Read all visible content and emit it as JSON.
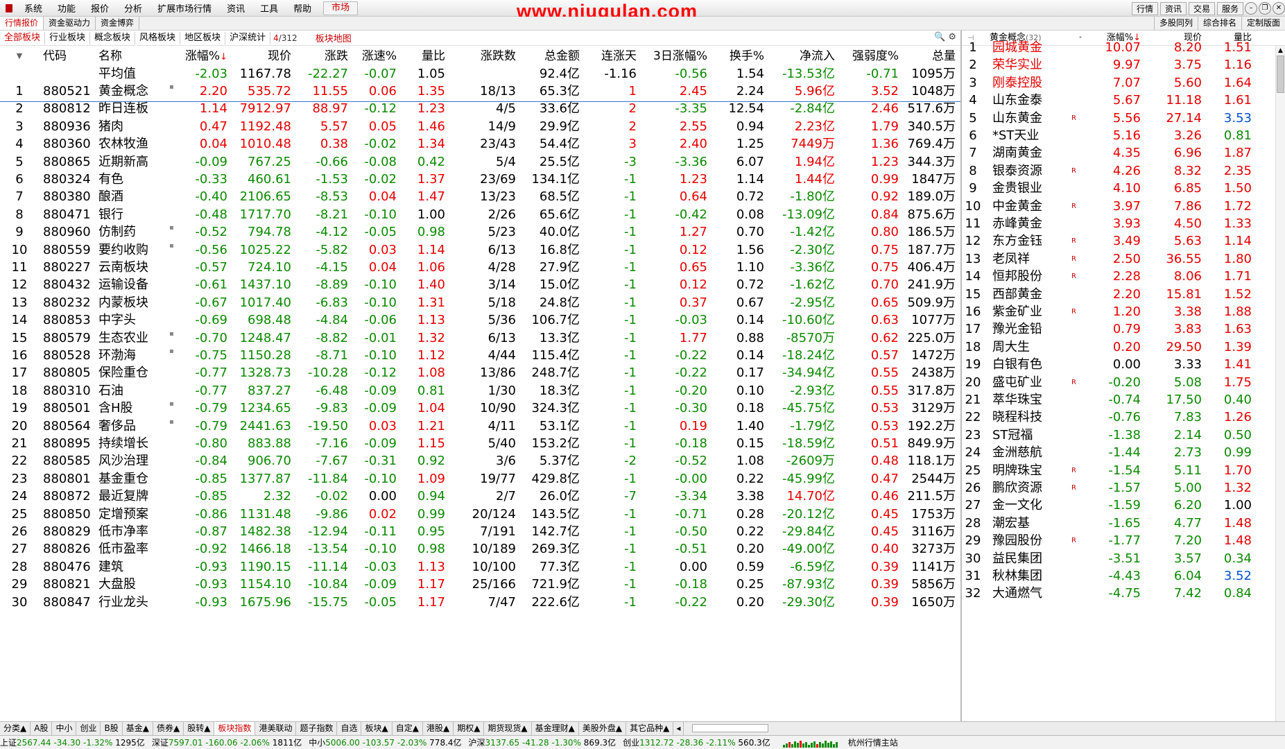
{
  "menu": {
    "items": [
      "系统",
      "功能",
      "报价",
      "分析",
      "扩展市场行情",
      "资讯",
      "工具",
      "帮助"
    ],
    "market": "市场",
    "banner": "www.niugulan.com",
    "right_buttons": [
      "行情",
      "资讯",
      "交易",
      "服务"
    ]
  },
  "toolbar2": {
    "tabs": [
      "行情报价",
      "资金驱动力",
      "资金博弈"
    ],
    "right_tabs": [
      "多股同列",
      "综合排名",
      "定制版面"
    ]
  },
  "sectorbar": {
    "tabs": [
      "全部板块",
      "行业板块",
      "概念板块",
      "风格板块",
      "地区板块",
      "沪深统计"
    ],
    "count_current": "4",
    "count_total": "/312",
    "map": "板块地图",
    "tools": "🔍 ⚙"
  },
  "table": {
    "headers": {
      "code": "代码",
      "name": "名称",
      "pct": "涨幅%",
      "price": "现价",
      "chg": "涨跌",
      "spd": "涨速%",
      "vr": "量比",
      "ud": "涨跌数",
      "amt": "总金额",
      "cd": "连涨天",
      "d3": "3日涨幅%",
      "hs": "换手%",
      "net": "净流入",
      "str": "强弱度%",
      "vol": "总量"
    },
    "avg": {
      "label": "平均值",
      "pct": "-2.03",
      "price": "1167.78",
      "chg": "-22.27",
      "spd": "-0.07",
      "vr": "1.05",
      "amt": "92.4亿",
      "cd": "-1.16",
      "d3": "-0.56",
      "hs": "1.54",
      "net": "-13.53亿",
      "str": "-0.71",
      "vol": "1095万"
    },
    "rows": [
      [
        "1",
        "880521",
        "黄金概念",
        1,
        "2.20",
        "535.72",
        "11.55",
        "0.06",
        "1.35",
        "18/13",
        "65.3亿",
        "1",
        "2.45",
        "2.24",
        "5.96亿",
        "3.52",
        "1048万"
      ],
      [
        "2",
        "880812",
        "昨日连板",
        0,
        "1.14",
        "7912.97",
        "88.97",
        "-0.12",
        "1.23",
        "4/5",
        "33.6亿",
        "2",
        "-3.35",
        "12.54",
        "-2.84亿",
        "2.46",
        "517.6万"
      ],
      [
        "3",
        "880936",
        "猪肉",
        0,
        "0.47",
        "1192.48",
        "5.57",
        "0.05",
        "1.46",
        "14/9",
        "29.9亿",
        "2",
        "2.55",
        "0.94",
        "2.23亿",
        "1.79",
        "340.5万"
      ],
      [
        "4",
        "880360",
        "农林牧渔",
        0,
        "0.04",
        "1010.48",
        "0.38",
        "-0.02",
        "1.34",
        "23/43",
        "54.4亿",
        "3",
        "2.40",
        "1.25",
        "7449万",
        "1.36",
        "769.4万"
      ],
      [
        "5",
        "880865",
        "近期新高",
        0,
        "-0.09",
        "767.25",
        "-0.66",
        "-0.08",
        "0.42",
        "5/4",
        "25.5亿",
        "-3",
        "-3.36",
        "6.07",
        "1.94亿",
        "1.23",
        "344.3万"
      ],
      [
        "6",
        "880324",
        "有色",
        0,
        "-0.33",
        "460.61",
        "-1.53",
        "-0.02",
        "1.37",
        "23/69",
        "134.1亿",
        "-1",
        "1.23",
        "1.14",
        "1.44亿",
        "0.99",
        "1847万"
      ],
      [
        "7",
        "880380",
        "酿酒",
        0,
        "-0.40",
        "2106.65",
        "-8.53",
        "0.04",
        "1.47",
        "13/23",
        "68.5亿",
        "-1",
        "0.64",
        "0.72",
        "-1.80亿",
        "0.92",
        "189.0万"
      ],
      [
        "8",
        "880471",
        "银行",
        0,
        "-0.48",
        "1717.70",
        "-8.21",
        "-0.10",
        "1.00",
        "2/26",
        "65.6亿",
        "-1",
        "-0.42",
        "0.08",
        "-13.09亿",
        "0.84",
        "875.6万"
      ],
      [
        "9",
        "880960",
        "仿制药",
        1,
        "-0.52",
        "794.78",
        "-4.12",
        "-0.05",
        "0.98",
        "5/23",
        "40.0亿",
        "-1",
        "1.27",
        "0.70",
        "-1.42亿",
        "0.80",
        "186.5万"
      ],
      [
        "10",
        "880559",
        "要约收购",
        1,
        "-0.56",
        "1025.22",
        "-5.82",
        "0.03",
        "1.14",
        "6/13",
        "16.8亿",
        "-1",
        "0.12",
        "1.56",
        "-2.30亿",
        "0.75",
        "187.7万"
      ],
      [
        "11",
        "880227",
        "云南板块",
        0,
        "-0.57",
        "724.10",
        "-4.15",
        "0.04",
        "1.06",
        "4/28",
        "27.9亿",
        "-1",
        "0.65",
        "1.10",
        "-3.36亿",
        "0.75",
        "406.4万"
      ],
      [
        "12",
        "880432",
        "运输设备",
        0,
        "-0.61",
        "1437.10",
        "-8.89",
        "-0.10",
        "1.40",
        "3/14",
        "15.0亿",
        "-1",
        "0.12",
        "0.72",
        "-1.62亿",
        "0.70",
        "241.9万"
      ],
      [
        "13",
        "880232",
        "内蒙板块",
        0,
        "-0.67",
        "1017.40",
        "-6.83",
        "-0.10",
        "1.31",
        "5/18",
        "24.8亿",
        "-1",
        "0.37",
        "0.67",
        "-2.95亿",
        "0.65",
        "509.9万"
      ],
      [
        "14",
        "880853",
        "中字头",
        0,
        "-0.69",
        "698.48",
        "-4.84",
        "-0.06",
        "1.13",
        "5/36",
        "106.7亿",
        "-1",
        "-0.03",
        "0.14",
        "-10.60亿",
        "0.63",
        "1077万"
      ],
      [
        "15",
        "880579",
        "生态农业",
        1,
        "-0.70",
        "1248.47",
        "-8.82",
        "-0.01",
        "1.32",
        "6/13",
        "13.3亿",
        "-1",
        "1.77",
        "0.88",
        "-8570万",
        "0.62",
        "225.0万"
      ],
      [
        "16",
        "880528",
        "环渤海",
        1,
        "-0.75",
        "1150.28",
        "-8.71",
        "-0.10",
        "1.12",
        "4/44",
        "115.4亿",
        "-1",
        "-0.22",
        "0.14",
        "-18.24亿",
        "0.57",
        "1472万"
      ],
      [
        "17",
        "880805",
        "保险重仓",
        0,
        "-0.77",
        "1328.73",
        "-10.28",
        "-0.12",
        "1.08",
        "13/86",
        "248.7亿",
        "-1",
        "-0.22",
        "0.17",
        "-34.94亿",
        "0.55",
        "2438万"
      ],
      [
        "18",
        "880310",
        "石油",
        0,
        "-0.77",
        "837.27",
        "-6.48",
        "-0.09",
        "0.81",
        "1/30",
        "18.3亿",
        "-1",
        "-0.20",
        "0.10",
        "-2.93亿",
        "0.55",
        "317.8万"
      ],
      [
        "19",
        "880501",
        "含H股",
        1,
        "-0.79",
        "1234.65",
        "-9.83",
        "-0.09",
        "1.04",
        "10/90",
        "324.3亿",
        "-1",
        "-0.30",
        "0.18",
        "-45.75亿",
        "0.53",
        "3129万"
      ],
      [
        "20",
        "880564",
        "奢侈品",
        1,
        "-0.79",
        "2441.63",
        "-19.50",
        "0.03",
        "1.21",
        "4/11",
        "53.1亿",
        "-1",
        "0.19",
        "1.40",
        "-1.79亿",
        "0.53",
        "192.2万"
      ],
      [
        "21",
        "880895",
        "持续增长",
        0,
        "-0.80",
        "883.88",
        "-7.16",
        "-0.09",
        "1.15",
        "5/40",
        "153.2亿",
        "-1",
        "-0.18",
        "0.15",
        "-18.59亿",
        "0.51",
        "849.9万"
      ],
      [
        "22",
        "880585",
        "风沙治理",
        0,
        "-0.84",
        "906.70",
        "-7.67",
        "-0.31",
        "0.92",
        "3/6",
        "5.37亿",
        "-2",
        "-0.52",
        "1.08",
        "-2609万",
        "0.48",
        "118.1万"
      ],
      [
        "23",
        "880801",
        "基金重仓",
        0,
        "-0.85",
        "1377.87",
        "-11.84",
        "-0.10",
        "1.09",
        "19/77",
        "429.8亿",
        "-1",
        "-0.00",
        "0.22",
        "-45.99亿",
        "0.47",
        "2544万"
      ],
      [
        "24",
        "880872",
        "最近复牌",
        0,
        "-0.85",
        "2.32",
        "-0.02",
        "0.00",
        "0.94",
        "2/7",
        "26.0亿",
        "-7",
        "-3.34",
        "3.38",
        "14.70亿",
        "0.46",
        "211.5万"
      ],
      [
        "25",
        "880850",
        "定增预案",
        0,
        "-0.86",
        "1131.48",
        "-9.86",
        "0.02",
        "0.99",
        "20/124",
        "143.5亿",
        "-1",
        "-0.71",
        "0.28",
        "-20.12亿",
        "0.45",
        "1753万"
      ],
      [
        "26",
        "880829",
        "低市净率",
        0,
        "-0.87",
        "1482.38",
        "-12.94",
        "-0.11",
        "0.95",
        "7/191",
        "142.7亿",
        "-1",
        "-0.50",
        "0.22",
        "-29.84亿",
        "0.45",
        "3116万"
      ],
      [
        "27",
        "880826",
        "低市盈率",
        0,
        "-0.92",
        "1466.18",
        "-13.54",
        "-0.10",
        "0.98",
        "10/189",
        "269.3亿",
        "-1",
        "-0.51",
        "0.20",
        "-49.00亿",
        "0.40",
        "3273万"
      ],
      [
        "28",
        "880476",
        "建筑",
        0,
        "-0.93",
        "1190.15",
        "-11.14",
        "-0.03",
        "1.13",
        "10/100",
        "77.3亿",
        "-1",
        "0.00",
        "0.59",
        "-6.59亿",
        "0.39",
        "1141万"
      ],
      [
        "29",
        "880821",
        "大盘股",
        0,
        "-0.93",
        "1154.10",
        "-10.84",
        "-0.09",
        "1.17",
        "25/166",
        "721.9亿",
        "-1",
        "-0.18",
        "0.25",
        "-87.93亿",
        "0.39",
        "5856万"
      ],
      [
        "30",
        "880847",
        "行业龙头",
        0,
        "-0.93",
        "1675.96",
        "-15.75",
        "-0.05",
        "1.17",
        "7/47",
        "222.6亿",
        "-1",
        "-0.22",
        "0.20",
        "-29.30亿",
        "0.39",
        "1650万"
      ]
    ]
  },
  "rpanel": {
    "title": "黄金概念",
    "title_count": "(32)",
    "h_pct": "涨幅%",
    "h_price": "现价",
    "h_vr": "量比",
    "rows": [
      [
        "1",
        "园城黄金",
        0,
        "10.07",
        "8.20",
        "1.51"
      ],
      [
        "2",
        "荣华实业",
        0,
        "9.97",
        "3.75",
        "1.16"
      ],
      [
        "3",
        "刚泰控股",
        0,
        "7.07",
        "5.60",
        "1.64"
      ],
      [
        "4",
        "山东金泰",
        0,
        "5.67",
        "11.18",
        "1.61"
      ],
      [
        "5",
        "山东黄金",
        1,
        "5.56",
        "27.14",
        "3.53"
      ],
      [
        "6",
        "*ST天业",
        0,
        "5.16",
        "3.26",
        "0.81"
      ],
      [
        "7",
        "湖南黄金",
        0,
        "4.35",
        "6.96",
        "1.87"
      ],
      [
        "8",
        "银泰资源",
        1,
        "4.26",
        "8.32",
        "2.35"
      ],
      [
        "9",
        "金贵银业",
        0,
        "4.10",
        "6.85",
        "1.50"
      ],
      [
        "10",
        "中金黄金",
        1,
        "3.97",
        "7.86",
        "1.72"
      ],
      [
        "11",
        "赤峰黄金",
        0,
        "3.93",
        "4.50",
        "1.33"
      ],
      [
        "12",
        "东方金钰",
        1,
        "3.49",
        "5.63",
        "1.14"
      ],
      [
        "13",
        "老凤祥",
        1,
        "2.50",
        "36.55",
        "1.80"
      ],
      [
        "14",
        "恒邦股份",
        1,
        "2.28",
        "8.06",
        "1.71"
      ],
      [
        "15",
        "西部黄金",
        0,
        "2.20",
        "15.81",
        "1.52"
      ],
      [
        "16",
        "紫金矿业",
        1,
        "1.20",
        "3.38",
        "1.88"
      ],
      [
        "17",
        "豫光金铅",
        0,
        "0.79",
        "3.83",
        "1.63"
      ],
      [
        "18",
        "周大生",
        0,
        "0.20",
        "29.50",
        "1.39"
      ],
      [
        "19",
        "白银有色",
        0,
        "0.00",
        "3.33",
        "1.41"
      ],
      [
        "20",
        "盛屯矿业",
        1,
        "-0.20",
        "5.08",
        "1.75"
      ],
      [
        "21",
        "萃华珠宝",
        0,
        "-0.74",
        "17.50",
        "0.40"
      ],
      [
        "22",
        "晓程科技",
        0,
        "-0.76",
        "7.83",
        "1.26"
      ],
      [
        "23",
        "ST冠福",
        0,
        "-1.38",
        "2.14",
        "0.50"
      ],
      [
        "24",
        "金洲慈航",
        0,
        "-1.44",
        "2.73",
        "0.99"
      ],
      [
        "25",
        "明牌珠宝",
        1,
        "-1.54",
        "5.11",
        "1.70"
      ],
      [
        "26",
        "鹏欣资源",
        1,
        "-1.57",
        "5.00",
        "1.32"
      ],
      [
        "27",
        "金一文化",
        0,
        "-1.59",
        "6.20",
        "1.00"
      ],
      [
        "28",
        "潮宏基",
        0,
        "-1.65",
        "4.77",
        "1.48"
      ],
      [
        "29",
        "豫园股份",
        1,
        "-1.77",
        "7.20",
        "1.48"
      ],
      [
        "30",
        "益民集团",
        0,
        "-3.51",
        "3.57",
        "0.34"
      ],
      [
        "31",
        "秋林集团",
        0,
        "-4.43",
        "6.04",
        "3.52"
      ],
      [
        "32",
        "大通燃气",
        0,
        "-4.75",
        "7.42",
        "0.84"
      ]
    ]
  },
  "bottomtabs": [
    "分类▲",
    "A股",
    "中小",
    "创业",
    "B股",
    "基金▲",
    "债券▲",
    "股转▲",
    "板块指数",
    "港美联动",
    "题子指数",
    "自选",
    "板块▲",
    "自定▲",
    "港股▲",
    "期权▲",
    "期货现货▲",
    "基金理财▲",
    "美股外盘▲",
    "其它品种▲"
  ],
  "bottom_active": "板块指数",
  "status": {
    "indices": [
      {
        "name": "上证",
        "val": "2567.44",
        "chg": "-34.30",
        "pct": "-1.32%",
        "amt": "1295亿"
      },
      {
        "name": "深证",
        "val": "7597.01",
        "chg": "-160.06",
        "pct": "-2.06%",
        "amt": "1811亿"
      },
      {
        "name": "中小",
        "val": "5006.00",
        "chg": "-103.57",
        "pct": "-2.03%",
        "amt": "778.4亿"
      },
      {
        "name": "沪深",
        "val": "3137.65",
        "chg": "-41.28",
        "pct": "-1.30%",
        "amt": "869.3亿"
      },
      {
        "name": "创业",
        "val": "1312.72",
        "chg": "-28.36",
        "pct": "-2.11%",
        "amt": "560.3亿"
      }
    ],
    "server": "杭州行情主站"
  },
  "colors": {
    "up": "#e60000",
    "down": "#0a8a00",
    "flat": "#000000",
    "accent": "#c00000"
  }
}
